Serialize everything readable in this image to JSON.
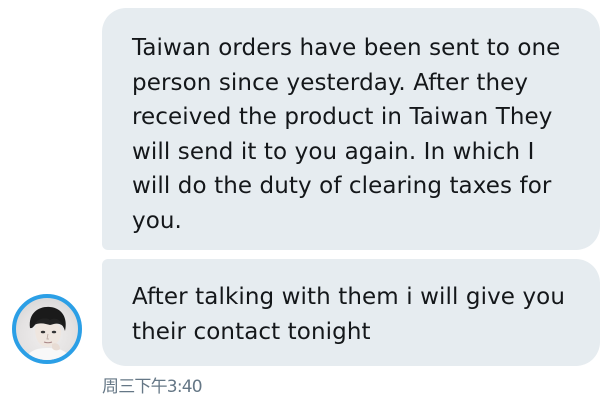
{
  "messages": [
    {
      "text": "Taiwan orders have been sent to one person since yesterday. After they received the product in Taiwan They will send it to you again. In which I will do the duty of clearing taxes for you."
    },
    {
      "text": "After talking with them i will give you their contact tonight"
    }
  ],
  "timestamp": "周三下午3:40",
  "colors": {
    "bubble_background": "#e6ecf0",
    "text": "#14171a",
    "timestamp": "#657786",
    "avatar_ring": "#2b9fe6"
  },
  "icons": {
    "avatar": "user-avatar-photo"
  }
}
